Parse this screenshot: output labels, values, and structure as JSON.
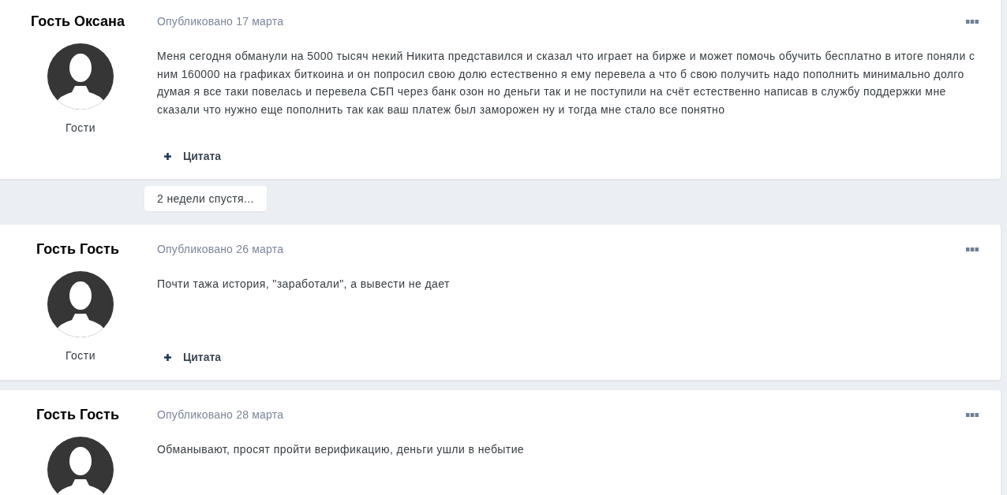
{
  "feed": [
    {
      "kind": "post",
      "author": "Гость Оксана",
      "group": "Гости",
      "date": "Опубликовано 17 марта",
      "body": "Меня сегодня обманули на 5000 тысяч некий Никита представился и сказал что играет на бирже и может помочь обучить бесплатно в итоге поняли с ним 160000 на графиках биткоина и он попросил свою долю естественно я ему перевела а что б свою получить надо пополнить минимально долго думая я все таки повелась и перевела СБП через банк озон но деньги так и не поступили на счёт естественно написав в службу поддержки мне сказали что нужно еще пополнить так как ваш платеж был заморожен ну и тогда мне стало все понятно",
      "quote_label": "Цитата"
    },
    {
      "kind": "time_gap",
      "label": "2 недели спустя..."
    },
    {
      "kind": "post",
      "author": "Гость Гость",
      "group": "Гости",
      "date": "Опубликовано 26 марта",
      "body": "Почти тажа история, \"заработали\", а вывести не дает",
      "quote_label": "Цитата"
    },
    {
      "kind": "post",
      "author": "Гость Гость",
      "date": "Опубликовано 28 марта",
      "body": "Обманывают, просят пройти верификацию, деньги ушли в небытие"
    }
  ]
}
